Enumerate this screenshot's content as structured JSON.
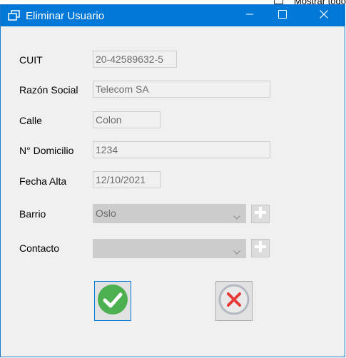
{
  "window": {
    "title": "Eliminar Usuario",
    "background_text": "Mostrar todo"
  },
  "form": {
    "cuit": {
      "label": "CUIT",
      "value": "20-42589632-5"
    },
    "razon_social": {
      "label": "Razón Social",
      "value": "Telecom SA"
    },
    "calle": {
      "label": "Calle",
      "value": "Colon"
    },
    "domicilio": {
      "label": "N° Domicilio",
      "value": "1234"
    },
    "fecha_alta": {
      "label": "Fecha Alta",
      "value": "12/10/2021"
    },
    "barrio": {
      "label": "Barrio",
      "selected": "Oslo"
    },
    "contacto": {
      "label": "Contacto",
      "selected": ""
    }
  },
  "icons": {
    "app": "windows-icon",
    "minimize": "minimize-icon",
    "maximize": "maximize-icon",
    "close": "close-icon",
    "add": "plus-icon",
    "confirm": "checkmark-icon",
    "cancel": "x-icon"
  },
  "colors": {
    "titlebar": "#0078d7",
    "confirm_green": "#4caf50",
    "cancel_red": "#e53935"
  }
}
